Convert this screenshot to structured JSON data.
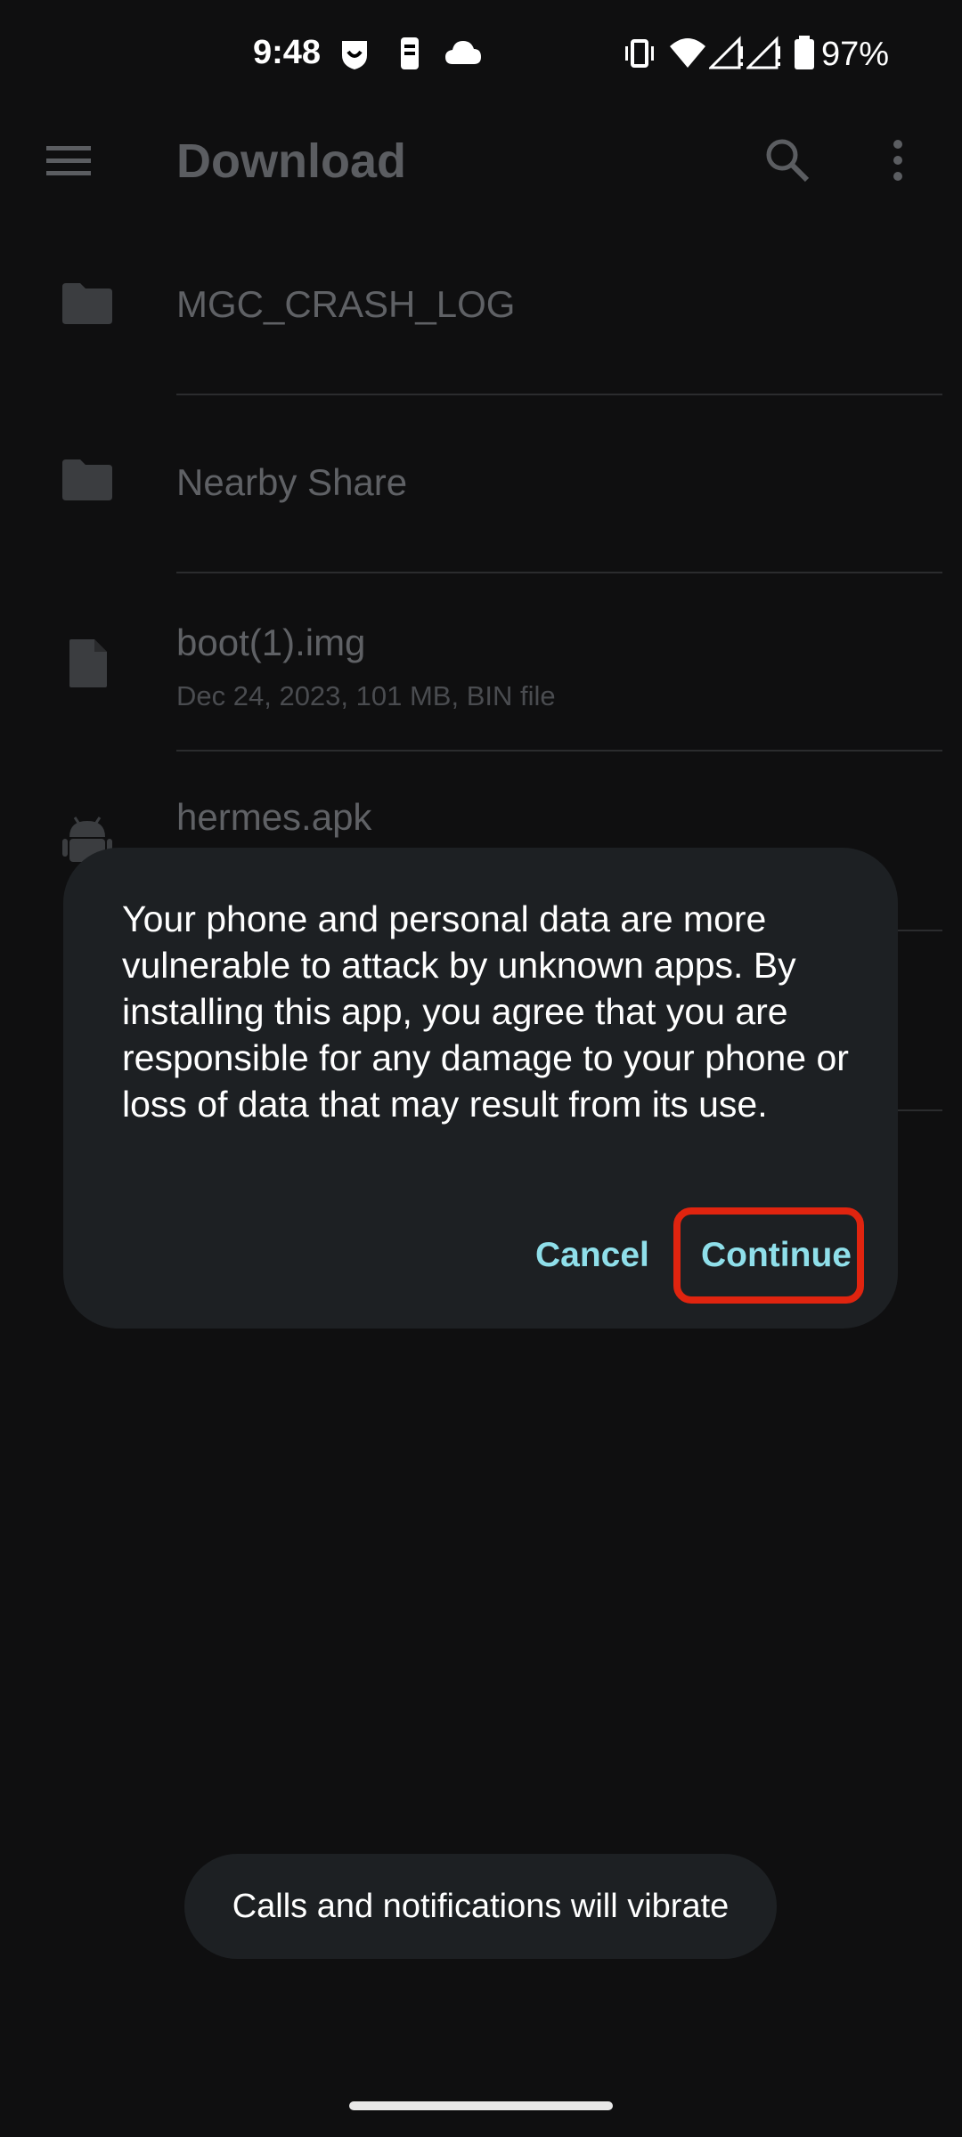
{
  "status_bar": {
    "time": "9:48",
    "battery_percent": "97%",
    "icons": [
      "shield-notification-icon",
      "phone-notification-icon",
      "cloud-icon",
      "vibrate-icon",
      "wifi-icon",
      "signal-icon",
      "signal-icon",
      "battery-icon"
    ]
  },
  "app_bar": {
    "title": "Download",
    "icons": [
      "menu-icon",
      "search-icon",
      "more-vert-icon"
    ]
  },
  "files": [
    {
      "name": "MGC_CRASH_LOG",
      "meta": "",
      "icon": "folder-icon"
    },
    {
      "name": "Nearby Share",
      "meta": "",
      "icon": "folder-icon"
    },
    {
      "name": "boot(1).img",
      "meta": "Dec 24, 2023, 101 MB, BIN file",
      "icon": "file-icon"
    },
    {
      "name": "hermes.apk",
      "meta": "",
      "icon": "android-icon"
    }
  ],
  "dialog": {
    "message": "Your phone and personal data are more vulnerable to attack by unknown apps. By installing this app, you agree that you are responsible for any damage to your phone or loss of data that may result from its use.",
    "cancel_label": "Cancel",
    "continue_label": "Continue"
  },
  "toast": {
    "text": "Calls and notifications will vibrate"
  },
  "colors": {
    "background": "#0f0f10",
    "dialog_bg": "#1d2023",
    "accent": "#8fdfea",
    "highlight": "#e0240f"
  }
}
